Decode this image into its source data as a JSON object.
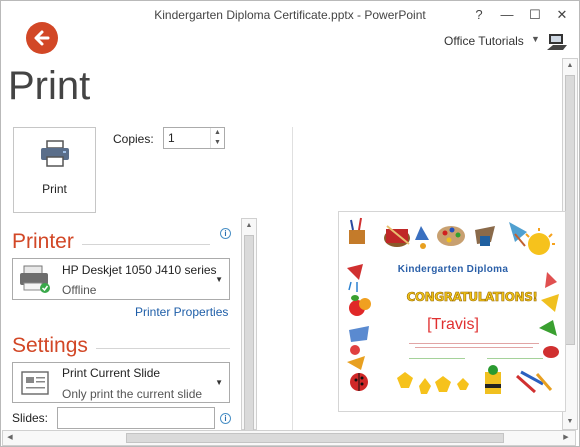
{
  "window": {
    "title": "Kindergarten Diploma Certificate.pptx - PowerPoint",
    "help": "?",
    "minimize": "—",
    "restore": "☐",
    "close": "✕",
    "account": "Office Tutorials"
  },
  "page": {
    "title": "Print"
  },
  "print": {
    "button_label": "Print"
  },
  "copies": {
    "label": "Copies:",
    "value": "1"
  },
  "printer": {
    "heading": "Printer",
    "name": "HP Deskjet 1050 J410 series",
    "status": "Offline",
    "properties_link": "Printer Properties"
  },
  "settings": {
    "heading": "Settings",
    "option": "Print Current Slide",
    "option_desc": "Only print the current slide",
    "slides_label": "Slides:",
    "slides_value": ""
  },
  "preview": {
    "title": "Kindergarten   Diploma",
    "congrats": "CONGRATULATIONS!",
    "name": "[Travis]"
  },
  "colors": {
    "accent": "#d24726",
    "link": "#1e5ea8"
  }
}
